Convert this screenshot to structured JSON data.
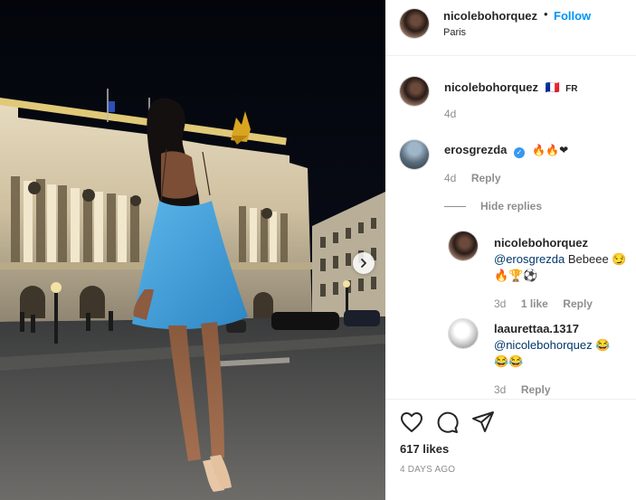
{
  "post": {
    "username": "nicolebohorquez",
    "follow_label": "Follow",
    "separator": "•",
    "location": "Paris"
  },
  "caption": {
    "username": "nicolebohorquez",
    "flag_text": "🇫🇷",
    "flag_label": "FR",
    "age": "4d"
  },
  "comments": [
    {
      "username": "erosgrezda",
      "verified": true,
      "text_emoji": "🔥🔥❤",
      "age": "4d",
      "reply_label": "Reply",
      "hide_replies_label": "Hide replies",
      "replies": [
        {
          "username": "nicolebohorquez",
          "mention": "@erosgrezda",
          "text": "Bebeee",
          "emoji_line1": "😏",
          "emoji_line2": "🔥🏆⚽",
          "age": "3d",
          "likes": "1 like",
          "reply_label": "Reply"
        },
        {
          "username": "laaurettaa.1317",
          "mention": "@nicolebohorquez",
          "emoji_line1": "😂",
          "emoji_line2": "😂😂",
          "age": "3d",
          "reply_label": "Reply"
        }
      ]
    }
  ],
  "footer": {
    "likes": "617 likes",
    "date": "4 DAYS AGO"
  },
  "icons": {
    "like": "heart-icon",
    "comment": "comment-icon",
    "share": "share-icon",
    "next": "chevron-right-icon",
    "verified": "verified-badge-icon"
  },
  "colors": {
    "accent": "#0095f6",
    "verified": "#3897f0",
    "mention": "#00376b",
    "muted": "#8e8e8e",
    "dress": "#4aa6dc"
  }
}
